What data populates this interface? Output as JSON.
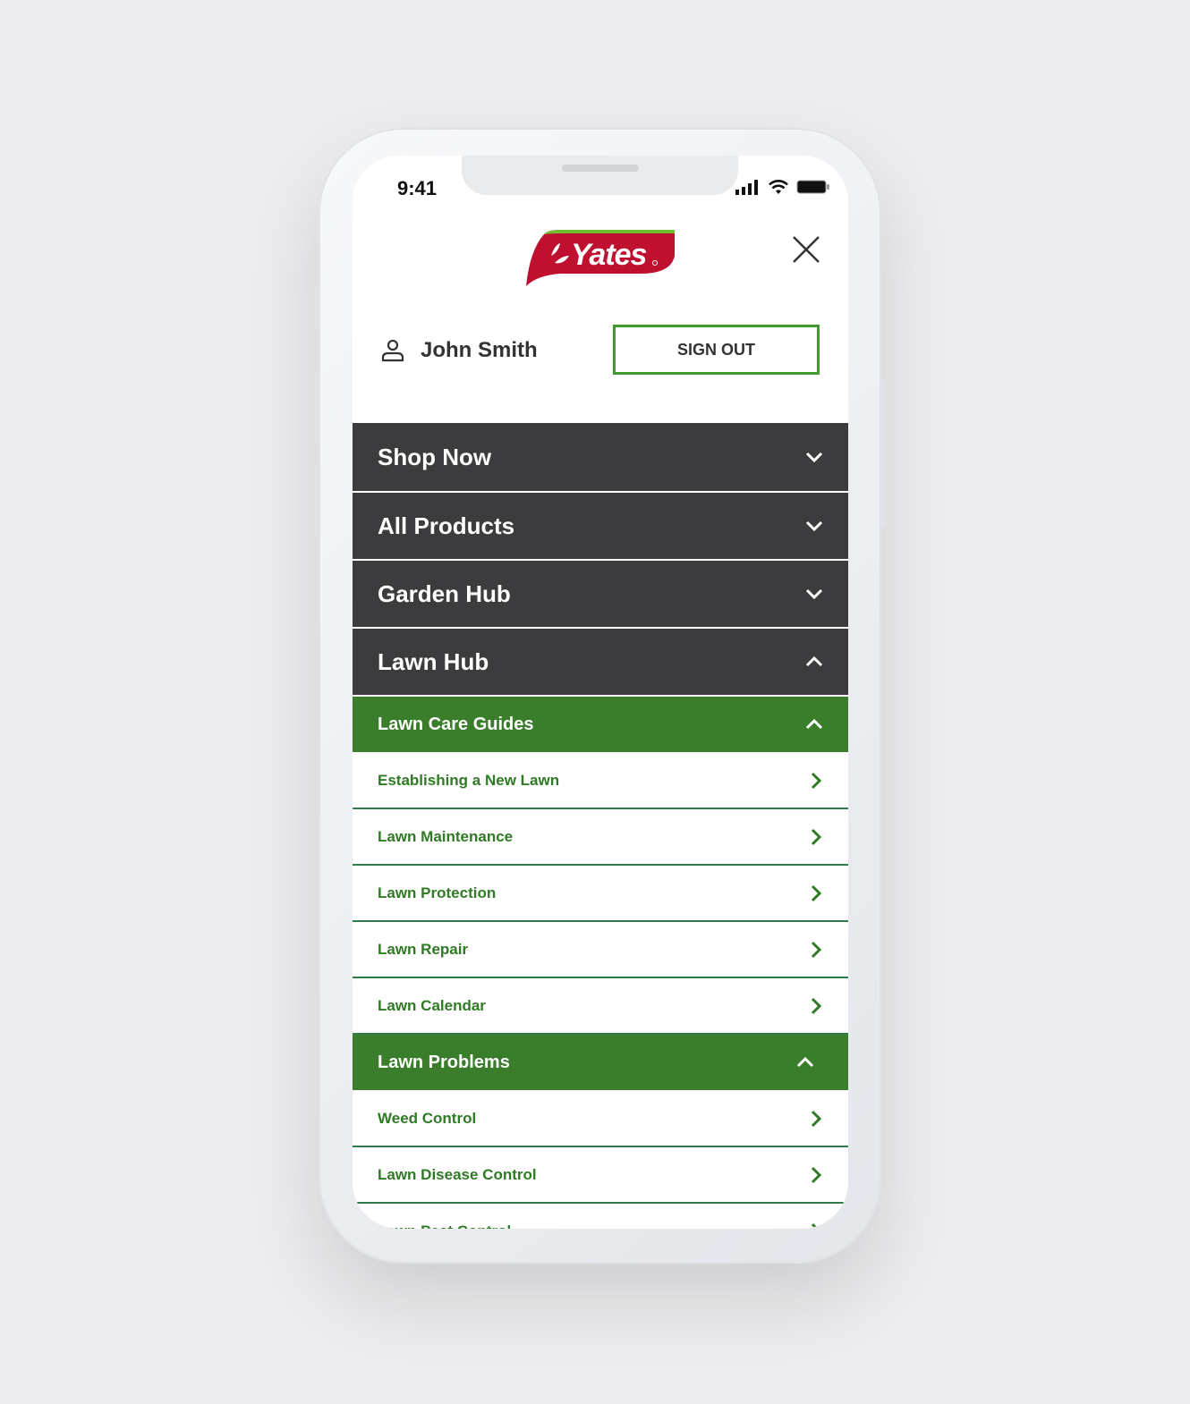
{
  "status_bar": {
    "time": "9:41",
    "icons": [
      "signal-icon",
      "wifi-icon",
      "battery-icon"
    ]
  },
  "header": {
    "logo_text": "Yates",
    "close_icon": "close-icon"
  },
  "user": {
    "name": "John Smith",
    "icon": "user-icon",
    "sign_out_label": "SIGN OUT"
  },
  "colors": {
    "dark_row": "#3c3c3e",
    "green": "#3a7d2a",
    "green_text": "#2f7a24",
    "logo_red": "#c0102f"
  },
  "menu": {
    "sections": [
      {
        "label": "Shop Now",
        "expanded": false
      },
      {
        "label": "All Products",
        "expanded": false
      },
      {
        "label": "Garden Hub",
        "expanded": false
      },
      {
        "label": "Lawn Hub",
        "expanded": true
      }
    ],
    "lawn_care_guides": {
      "label": "Lawn Care Guides",
      "items": [
        "Establishing a New Lawn",
        "Lawn Maintenance",
        "Lawn Protection",
        "Lawn Repair",
        "Lawn Calendar"
      ]
    },
    "lawn_problems": {
      "label": "Lawn Problems",
      "items": [
        "Weed Control",
        "Lawn Disease Control",
        "Lawn Pest Control"
      ]
    }
  }
}
